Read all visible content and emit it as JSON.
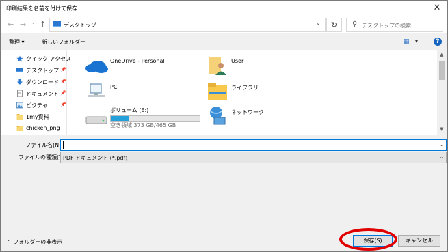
{
  "window": {
    "title": "印刷結果を名前を付けて保存",
    "close_glyph": "✕"
  },
  "nav_buttons": {
    "back": "←",
    "forward": "→",
    "dropdown": "⌄",
    "up": "↑"
  },
  "address": {
    "location": "デスクトップ",
    "chevron": "›",
    "dropdown": "⌄"
  },
  "refresh": "↻",
  "search": {
    "placeholder": "デスクトップの検索"
  },
  "toolbar": {
    "organize": "整理 ▾",
    "new_folder": "新しいフォルダー",
    "view_dd": "▾",
    "help": "?"
  },
  "nav_pane": {
    "quick_access": "クイック アクセス",
    "items": [
      {
        "label": "デスクトップ",
        "pinned": true
      },
      {
        "label": "ダウンロード",
        "pinned": true
      },
      {
        "label": "ドキュメント",
        "pinned": true
      },
      {
        "label": "ピクチャ",
        "pinned": true
      },
      {
        "label": "1my資料",
        "pinned": false
      },
      {
        "label": "chicken_png",
        "pinned": false
      }
    ]
  },
  "items": [
    {
      "label": "OneDrive - Personal"
    },
    {
      "label": "User"
    },
    {
      "label": "PC"
    },
    {
      "label": "ライブラリ"
    },
    {
      "label": "ボリューム (E:)",
      "sub": "空き領域 373 GB/465 GB",
      "used_fraction": 0.2
    },
    {
      "label": "ネットワーク"
    }
  ],
  "fields": {
    "filename_label": "ファイル名(N):",
    "filename_value": "",
    "filetype_label": "ファイルの種類(T):",
    "filetype_value": "PDF ドキュメント (*.pdf)"
  },
  "footer": {
    "hide_folders": "フォルダーの非表示",
    "save": "保存(S)",
    "cancel": "キャンセル"
  },
  "colors": {
    "accent": "#0078d7",
    "highlight": "#e00000",
    "storage": "#26a0da"
  }
}
